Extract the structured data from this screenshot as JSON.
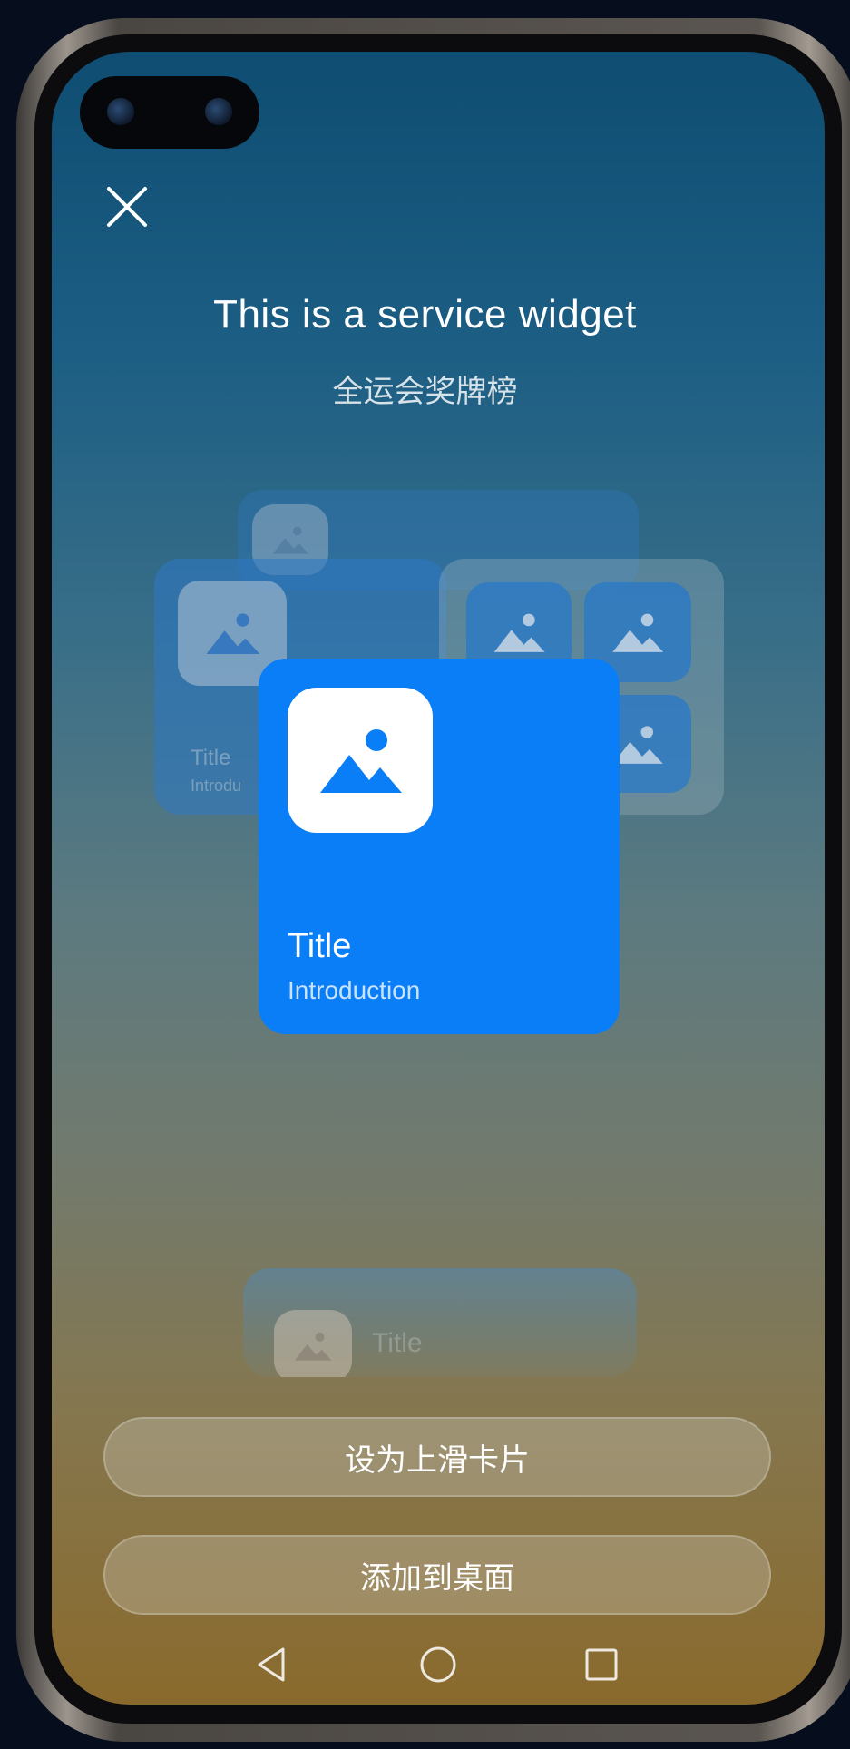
{
  "header": {
    "title": "This is a service widget",
    "subtitle": "全运会奖牌榜"
  },
  "widget": {
    "title": "Title",
    "introduction": "Introduction"
  },
  "background_previews": {
    "left_title": "Title",
    "left_intro": "Introdu",
    "lower_title": "Title"
  },
  "actions": {
    "set_swipe_card": "设为上滑卡片",
    "add_to_desktop": "添加到桌面"
  },
  "icons": {
    "close": "close-icon",
    "image_placeholder": "image-icon",
    "back": "back-icon",
    "home": "home-icon",
    "recents": "recents-icon"
  },
  "colors": {
    "widget_blue": "#0a7ef7",
    "text_white": "#ffffff"
  }
}
